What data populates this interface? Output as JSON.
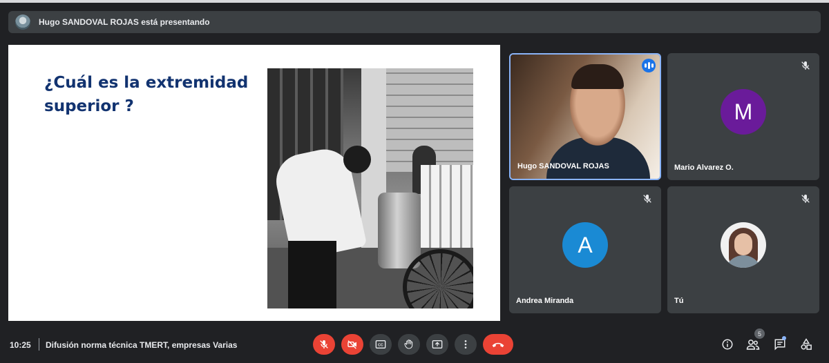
{
  "banner": {
    "text": "Hugo SANDOVAL ROJAS está presentando"
  },
  "slide": {
    "title": "¿Cuál es la extremidad superior ?"
  },
  "participants": [
    {
      "name": "Hugo SANDOVAL ROJAS",
      "speaking": true
    },
    {
      "name": "Mario Alvarez O.",
      "initial": "M",
      "avatar_color": "#6a1b9a",
      "muted": true
    },
    {
      "name": "Andrea Miranda",
      "initial": "A",
      "avatar_color": "#1a8ad4",
      "muted": true
    },
    {
      "name": "Tú",
      "muted": true
    }
  ],
  "bottombar": {
    "time": "10:25",
    "meeting_title": "Difusión norma técnica TMERT, empresas Varias",
    "controls": [
      "mic-off-icon",
      "camera-off-icon",
      "captions-icon",
      "raise-hand-icon",
      "present-icon",
      "more-options-icon",
      "hangup-icon"
    ],
    "participants_count": "5",
    "hangup_color": "#ea4335",
    "mic_off_color": "#ea4335"
  },
  "colors": {
    "accent": "#8ab4f8",
    "background": "#202124",
    "tile": "#3c4043",
    "slide_title": "#123370"
  }
}
